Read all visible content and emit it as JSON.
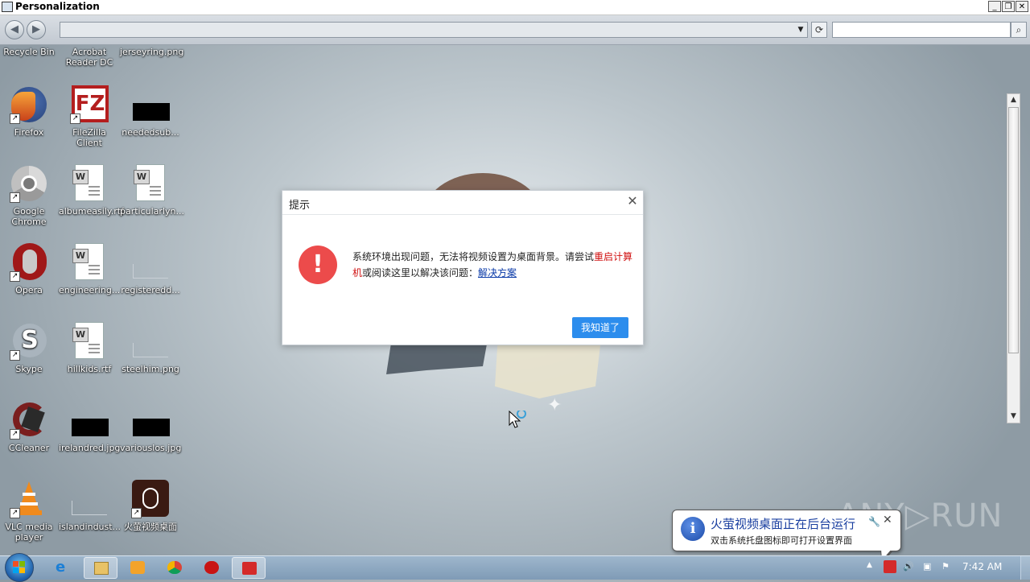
{
  "window": {
    "title": "Personalization",
    "min": "_",
    "restore": "❐",
    "close": "✕"
  },
  "addressbar": {
    "back": "◀",
    "forward": "▶",
    "address": "",
    "search_placeholder": "",
    "dropdown": "▼",
    "refresh": "⟳",
    "search_icon": "⌕"
  },
  "desktop_icons": [
    {
      "label": "Recycle Bin",
      "icon": "recycle-bin-icon"
    },
    {
      "label": "Acrobat Reader DC",
      "icon": "acrobat-icon"
    },
    {
      "label": "jerseyring.png",
      "icon": "image-file-icon"
    },
    {
      "label": "Firefox",
      "icon": "firefox-icon"
    },
    {
      "label": "FileZilla Client",
      "icon": "filezilla-icon"
    },
    {
      "label": "neededsub...",
      "icon": "image-file-icon"
    },
    {
      "label": "Google Chrome",
      "icon": "chrome-icon"
    },
    {
      "label": "albumeasily.rtf",
      "icon": "word-doc-icon"
    },
    {
      "label": "particularlyn...",
      "icon": "word-doc-icon"
    },
    {
      "label": "Opera",
      "icon": "opera-icon"
    },
    {
      "label": "engineering...",
      "icon": "word-doc-icon"
    },
    {
      "label": "registeredd...",
      "icon": "file-icon"
    },
    {
      "label": "Skype",
      "icon": "skype-icon"
    },
    {
      "label": "hillkids.rtf",
      "icon": "word-doc-icon"
    },
    {
      "label": "steelhim.png",
      "icon": "file-icon"
    },
    {
      "label": "CCleaner",
      "icon": "ccleaner-icon"
    },
    {
      "label": "irelandred.jpg",
      "icon": "image-file-icon"
    },
    {
      "label": "variouslos.jpg",
      "icon": "image-file-icon"
    },
    {
      "label": "VLC media player",
      "icon": "vlc-icon"
    },
    {
      "label": "islandindust...",
      "icon": "file-icon"
    },
    {
      "label": "火萤视频桌面",
      "icon": "firefly-icon"
    }
  ],
  "shortcut_arrow": "↗",
  "dialog": {
    "title": "提示",
    "close": "✕",
    "alert_symbol": "!",
    "msg_part1": "系统环境出现问题，无法将视频设置为桌面背景。请尝试",
    "msg_red": "重启计算机",
    "msg_part2": "或阅读这里以解决该问题：",
    "msg_link": "解决方案",
    "ok_button": "我知道了"
  },
  "balloon": {
    "title": "火萤视频桌面正在后台运行",
    "text": "双击系统托盘图标即可打开设置界面",
    "info_symbol": "i",
    "wrench": "🔧",
    "close": "✕"
  },
  "watermark": "ANY▷RUN",
  "taskbar": {
    "clock": "7:42 AM",
    "tray_up": "▲",
    "items": [
      "internet-explorer-icon",
      "explorer-icon",
      "media-player-icon",
      "chrome-icon",
      "opera-icon",
      "firefly-icon"
    ]
  },
  "colors": {
    "dialog_ok": "#2c8ded",
    "alert_red": "#ec4b4b",
    "msg_red": "#d01010",
    "link_blue": "#0a3aa8"
  }
}
